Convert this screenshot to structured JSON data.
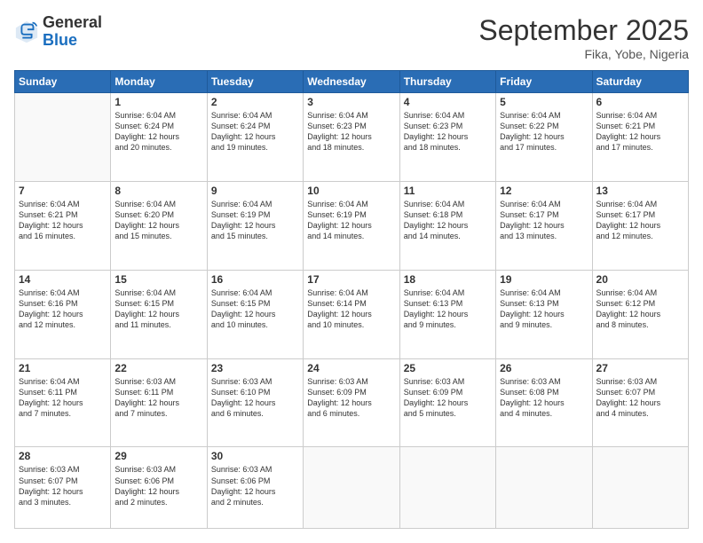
{
  "logo": {
    "general": "General",
    "blue": "Blue"
  },
  "title": {
    "month": "September 2025",
    "location": "Fika, Yobe, Nigeria"
  },
  "headers": [
    "Sunday",
    "Monday",
    "Tuesday",
    "Wednesday",
    "Thursday",
    "Friday",
    "Saturday"
  ],
  "weeks": [
    [
      {
        "day": "",
        "info": ""
      },
      {
        "day": "1",
        "info": "Sunrise: 6:04 AM\nSunset: 6:24 PM\nDaylight: 12 hours\nand 20 minutes."
      },
      {
        "day": "2",
        "info": "Sunrise: 6:04 AM\nSunset: 6:24 PM\nDaylight: 12 hours\nand 19 minutes."
      },
      {
        "day": "3",
        "info": "Sunrise: 6:04 AM\nSunset: 6:23 PM\nDaylight: 12 hours\nand 18 minutes."
      },
      {
        "day": "4",
        "info": "Sunrise: 6:04 AM\nSunset: 6:23 PM\nDaylight: 12 hours\nand 18 minutes."
      },
      {
        "day": "5",
        "info": "Sunrise: 6:04 AM\nSunset: 6:22 PM\nDaylight: 12 hours\nand 17 minutes."
      },
      {
        "day": "6",
        "info": "Sunrise: 6:04 AM\nSunset: 6:21 PM\nDaylight: 12 hours\nand 17 minutes."
      }
    ],
    [
      {
        "day": "7",
        "info": "Sunrise: 6:04 AM\nSunset: 6:21 PM\nDaylight: 12 hours\nand 16 minutes."
      },
      {
        "day": "8",
        "info": "Sunrise: 6:04 AM\nSunset: 6:20 PM\nDaylight: 12 hours\nand 15 minutes."
      },
      {
        "day": "9",
        "info": "Sunrise: 6:04 AM\nSunset: 6:19 PM\nDaylight: 12 hours\nand 15 minutes."
      },
      {
        "day": "10",
        "info": "Sunrise: 6:04 AM\nSunset: 6:19 PM\nDaylight: 12 hours\nand 14 minutes."
      },
      {
        "day": "11",
        "info": "Sunrise: 6:04 AM\nSunset: 6:18 PM\nDaylight: 12 hours\nand 14 minutes."
      },
      {
        "day": "12",
        "info": "Sunrise: 6:04 AM\nSunset: 6:17 PM\nDaylight: 12 hours\nand 13 minutes."
      },
      {
        "day": "13",
        "info": "Sunrise: 6:04 AM\nSunset: 6:17 PM\nDaylight: 12 hours\nand 12 minutes."
      }
    ],
    [
      {
        "day": "14",
        "info": "Sunrise: 6:04 AM\nSunset: 6:16 PM\nDaylight: 12 hours\nand 12 minutes."
      },
      {
        "day": "15",
        "info": "Sunrise: 6:04 AM\nSunset: 6:15 PM\nDaylight: 12 hours\nand 11 minutes."
      },
      {
        "day": "16",
        "info": "Sunrise: 6:04 AM\nSunset: 6:15 PM\nDaylight: 12 hours\nand 10 minutes."
      },
      {
        "day": "17",
        "info": "Sunrise: 6:04 AM\nSunset: 6:14 PM\nDaylight: 12 hours\nand 10 minutes."
      },
      {
        "day": "18",
        "info": "Sunrise: 6:04 AM\nSunset: 6:13 PM\nDaylight: 12 hours\nand 9 minutes."
      },
      {
        "day": "19",
        "info": "Sunrise: 6:04 AM\nSunset: 6:13 PM\nDaylight: 12 hours\nand 9 minutes."
      },
      {
        "day": "20",
        "info": "Sunrise: 6:04 AM\nSunset: 6:12 PM\nDaylight: 12 hours\nand 8 minutes."
      }
    ],
    [
      {
        "day": "21",
        "info": "Sunrise: 6:04 AM\nSunset: 6:11 PM\nDaylight: 12 hours\nand 7 minutes."
      },
      {
        "day": "22",
        "info": "Sunrise: 6:03 AM\nSunset: 6:11 PM\nDaylight: 12 hours\nand 7 minutes."
      },
      {
        "day": "23",
        "info": "Sunrise: 6:03 AM\nSunset: 6:10 PM\nDaylight: 12 hours\nand 6 minutes."
      },
      {
        "day": "24",
        "info": "Sunrise: 6:03 AM\nSunset: 6:09 PM\nDaylight: 12 hours\nand 6 minutes."
      },
      {
        "day": "25",
        "info": "Sunrise: 6:03 AM\nSunset: 6:09 PM\nDaylight: 12 hours\nand 5 minutes."
      },
      {
        "day": "26",
        "info": "Sunrise: 6:03 AM\nSunset: 6:08 PM\nDaylight: 12 hours\nand 4 minutes."
      },
      {
        "day": "27",
        "info": "Sunrise: 6:03 AM\nSunset: 6:07 PM\nDaylight: 12 hours\nand 4 minutes."
      }
    ],
    [
      {
        "day": "28",
        "info": "Sunrise: 6:03 AM\nSunset: 6:07 PM\nDaylight: 12 hours\nand 3 minutes."
      },
      {
        "day": "29",
        "info": "Sunrise: 6:03 AM\nSunset: 6:06 PM\nDaylight: 12 hours\nand 2 minutes."
      },
      {
        "day": "30",
        "info": "Sunrise: 6:03 AM\nSunset: 6:06 PM\nDaylight: 12 hours\nand 2 minutes."
      },
      {
        "day": "",
        "info": ""
      },
      {
        "day": "",
        "info": ""
      },
      {
        "day": "",
        "info": ""
      },
      {
        "day": "",
        "info": ""
      }
    ]
  ]
}
